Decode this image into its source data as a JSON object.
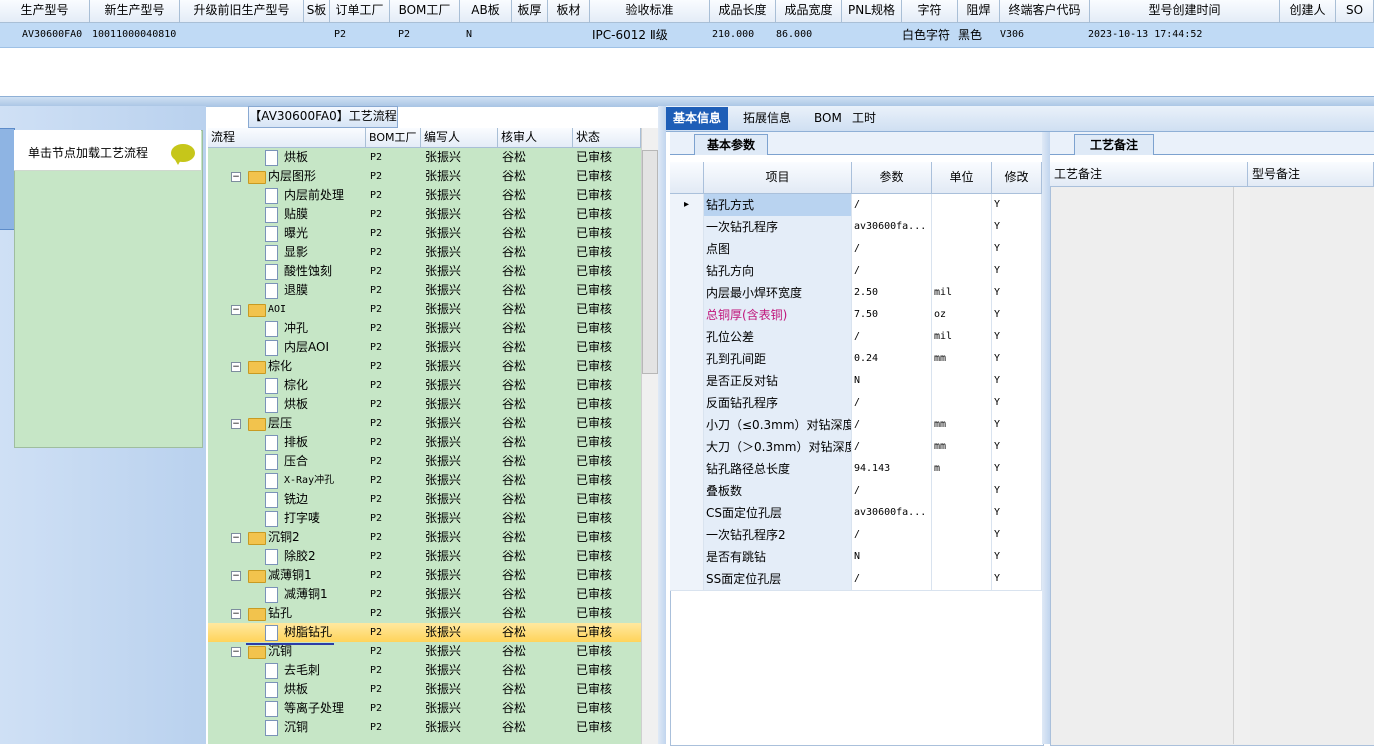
{
  "top_grid": {
    "headers": [
      "生产型号",
      "新生产型号",
      "升级前旧生产型号",
      "S板",
      "订单工厂",
      "BOM工厂",
      "AB板",
      "板厚",
      "板材",
      "验收标准",
      "成品长度",
      "成品宽度",
      "PNL规格",
      "字符",
      "阻焊",
      "终端客户代码",
      "型号创建时间",
      "创建人",
      "SO"
    ],
    "row": [
      "AV30600FA0",
      "10011000040810",
      "",
      "",
      "P2",
      "P2",
      "N",
      "",
      "",
      "IPC-6012 Ⅱ级",
      "210.000",
      "86.000",
      "",
      "白色字符",
      "黑色",
      "V306",
      "2023-10-13 17:44:52",
      "",
      ""
    ]
  },
  "left_pane": {
    "load_hint": "单击节点加载工艺流程"
  },
  "tree": {
    "title": "【AV30600FA0】工艺流程",
    "headers": [
      "流程",
      "BOM工厂",
      "编写人",
      "核审人",
      "状态"
    ],
    "rows": [
      {
        "label": "烘板",
        "type": "doc",
        "factory": "P2",
        "writer": "张振兴",
        "reviewer": "谷松",
        "status": "已审核"
      },
      {
        "label": "内层图形",
        "type": "folder",
        "factory": "P2",
        "writer": "张振兴",
        "reviewer": "谷松",
        "status": "已审核"
      },
      {
        "label": "内层前处理",
        "type": "doc",
        "factory": "P2",
        "writer": "张振兴",
        "reviewer": "谷松",
        "status": "已审核"
      },
      {
        "label": "贴膜",
        "type": "doc",
        "factory": "P2",
        "writer": "张振兴",
        "reviewer": "谷松",
        "status": "已审核"
      },
      {
        "label": "曝光",
        "type": "doc",
        "factory": "P2",
        "writer": "张振兴",
        "reviewer": "谷松",
        "status": "已审核"
      },
      {
        "label": "显影",
        "type": "doc",
        "factory": "P2",
        "writer": "张振兴",
        "reviewer": "谷松",
        "status": "已审核"
      },
      {
        "label": "酸性蚀刻",
        "type": "doc",
        "factory": "P2",
        "writer": "张振兴",
        "reviewer": "谷松",
        "status": "已审核"
      },
      {
        "label": "退膜",
        "type": "doc",
        "factory": "P2",
        "writer": "张振兴",
        "reviewer": "谷松",
        "status": "已审核"
      },
      {
        "label": "AOI",
        "type": "folder",
        "factory": "P2",
        "writer": "张振兴",
        "reviewer": "谷松",
        "status": "已审核"
      },
      {
        "label": "冲孔",
        "type": "doc",
        "factory": "P2",
        "writer": "张振兴",
        "reviewer": "谷松",
        "status": "已审核"
      },
      {
        "label": "内层AOI",
        "type": "doc",
        "factory": "P2",
        "writer": "张振兴",
        "reviewer": "谷松",
        "status": "已审核"
      },
      {
        "label": "棕化",
        "type": "folder",
        "factory": "P2",
        "writer": "张振兴",
        "reviewer": "谷松",
        "status": "已审核"
      },
      {
        "label": "棕化",
        "type": "doc",
        "factory": "P2",
        "writer": "张振兴",
        "reviewer": "谷松",
        "status": "已审核"
      },
      {
        "label": "烘板",
        "type": "doc",
        "factory": "P2",
        "writer": "张振兴",
        "reviewer": "谷松",
        "status": "已审核"
      },
      {
        "label": "层压",
        "type": "folder",
        "factory": "P2",
        "writer": "张振兴",
        "reviewer": "谷松",
        "status": "已审核"
      },
      {
        "label": "排板",
        "type": "doc",
        "factory": "P2",
        "writer": "张振兴",
        "reviewer": "谷松",
        "status": "已审核"
      },
      {
        "label": "压合",
        "type": "doc",
        "factory": "P2",
        "writer": "张振兴",
        "reviewer": "谷松",
        "status": "已审核"
      },
      {
        "label": "X-Ray冲孔",
        "type": "doc",
        "factory": "P2",
        "writer": "张振兴",
        "reviewer": "谷松",
        "status": "已审核"
      },
      {
        "label": "铣边",
        "type": "doc",
        "factory": "P2",
        "writer": "张振兴",
        "reviewer": "谷松",
        "status": "已审核"
      },
      {
        "label": "打字唛",
        "type": "doc",
        "factory": "P2",
        "writer": "张振兴",
        "reviewer": "谷松",
        "status": "已审核"
      },
      {
        "label": "沉铜2",
        "type": "folder",
        "factory": "P2",
        "writer": "张振兴",
        "reviewer": "谷松",
        "status": "已审核"
      },
      {
        "label": "除胶2",
        "type": "doc",
        "factory": "P2",
        "writer": "张振兴",
        "reviewer": "谷松",
        "status": "已审核"
      },
      {
        "label": "减薄铜1",
        "type": "folder",
        "factory": "P2",
        "writer": "张振兴",
        "reviewer": "谷松",
        "status": "已审核"
      },
      {
        "label": "减薄铜1",
        "type": "doc",
        "factory": "P2",
        "writer": "张振兴",
        "reviewer": "谷松",
        "status": "已审核"
      },
      {
        "label": "钻孔",
        "type": "folder",
        "factory": "P2",
        "writer": "张振兴",
        "reviewer": "谷松",
        "status": "已审核"
      },
      {
        "label": "树脂钻孔",
        "type": "doc",
        "factory": "P2",
        "writer": "张振兴",
        "reviewer": "谷松",
        "status": "已审核",
        "selected": true
      },
      {
        "label": "沉铜",
        "type": "folder",
        "factory": "P2",
        "writer": "张振兴",
        "reviewer": "谷松",
        "status": "已审核"
      },
      {
        "label": "去毛刺",
        "type": "doc",
        "factory": "P2",
        "writer": "张振兴",
        "reviewer": "谷松",
        "status": "已审核"
      },
      {
        "label": "烘板",
        "type": "doc",
        "factory": "P2",
        "writer": "张振兴",
        "reviewer": "谷松",
        "status": "已审核"
      },
      {
        "label": "等离子处理",
        "type": "doc",
        "factory": "P2",
        "writer": "张振兴",
        "reviewer": "谷松",
        "status": "已审核"
      },
      {
        "label": "沉铜",
        "type": "doc",
        "factory": "P2",
        "writer": "张振兴",
        "reviewer": "谷松",
        "status": "已审核"
      }
    ]
  },
  "right_panel": {
    "tabs": [
      "基本信息",
      "拓展信息",
      "BOM",
      "工时"
    ],
    "sub_tab": "基本参数",
    "grid_headers": [
      "项目",
      "参数",
      "单位",
      "修改"
    ],
    "rows": [
      {
        "item": "钻孔方式",
        "value": "/",
        "unit": "",
        "mod": "Y",
        "current": true
      },
      {
        "item": "一次钻孔程序",
        "value": "av30600fa...",
        "unit": "",
        "mod": "Y"
      },
      {
        "item": "点图",
        "value": "/",
        "unit": "",
        "mod": "Y"
      },
      {
        "item": "钻孔方向",
        "value": "/",
        "unit": "",
        "mod": "Y"
      },
      {
        "item": "内层最小焊环宽度",
        "value": "2.50",
        "unit": "mil",
        "mod": "Y"
      },
      {
        "item": "总铜厚(含表铜)",
        "value": "7.50",
        "unit": "oz",
        "mod": "Y",
        "red": true
      },
      {
        "item": "孔位公差",
        "value": "/",
        "unit": "mil",
        "mod": "Y"
      },
      {
        "item": "孔到孔间距",
        "value": "0.24",
        "unit": "mm",
        "mod": "Y"
      },
      {
        "item": "是否正反对钻",
        "value": "N",
        "unit": "",
        "mod": "Y"
      },
      {
        "item": "反面钻孔程序",
        "value": "/",
        "unit": "",
        "mod": "Y"
      },
      {
        "item": "小刀（≤0.3mm）对钻深度",
        "value": "/",
        "unit": "mm",
        "mod": "Y"
      },
      {
        "item": "大刀（＞0.3mm）对钻深度",
        "value": "/",
        "unit": "mm",
        "mod": "Y"
      },
      {
        "item": "钻孔路径总长度",
        "value": "94.143",
        "unit": "m",
        "mod": "Y"
      },
      {
        "item": "叠板数",
        "value": "/",
        "unit": "",
        "mod": "Y"
      },
      {
        "item": "CS面定位孔层",
        "value": "av30600fa...",
        "unit": "",
        "mod": "Y"
      },
      {
        "item": "一次钻孔程序2",
        "value": "/",
        "unit": "",
        "mod": "Y"
      },
      {
        "item": "是否有跳钻",
        "value": "N",
        "unit": "",
        "mod": "Y"
      },
      {
        "item": "SS面定位孔层",
        "value": "/",
        "unit": "",
        "mod": "Y"
      }
    ]
  },
  "notes_panel": {
    "tab": "工艺备注",
    "headers": [
      "工艺备注",
      "型号备注"
    ]
  }
}
